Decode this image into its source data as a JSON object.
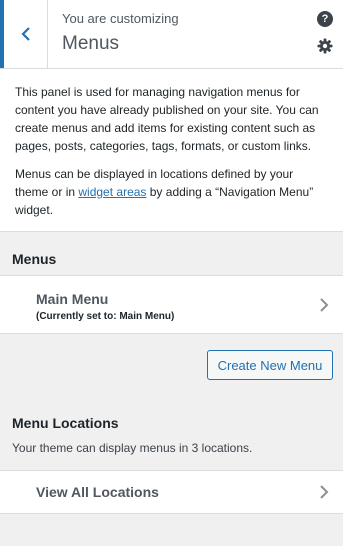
{
  "header": {
    "subtitle": "You are customizing",
    "title": "Menus",
    "help_glyph": "?"
  },
  "description": {
    "paragraph1": "This panel is used for managing navigation menus for content you have already published on your site. You can create menus and add items for existing content such as pages, posts, categories, tags, formats, or custom links.",
    "paragraph2_before": "Menus can be displayed in locations defined by your theme or in ",
    "paragraph2_link": "widget areas",
    "paragraph2_after": " by adding a “Navigation Menu” widget."
  },
  "menus_section": {
    "heading": "Menus",
    "items": [
      {
        "title": "Main Menu",
        "subtitle": "(Currently set to: Main Menu)"
      }
    ],
    "create_button": "Create New Menu"
  },
  "locations_section": {
    "heading": "Menu Locations",
    "description": "Your theme can display menus in 3 locations.",
    "view_all": "View All Locations"
  },
  "colors": {
    "accent": "#2271b1",
    "panel_bg": "#f0f0f1",
    "text": "#1d2327"
  },
  "icons": [
    "back-arrow-icon",
    "help-icon",
    "gear-icon",
    "chevron-right-icon"
  ]
}
